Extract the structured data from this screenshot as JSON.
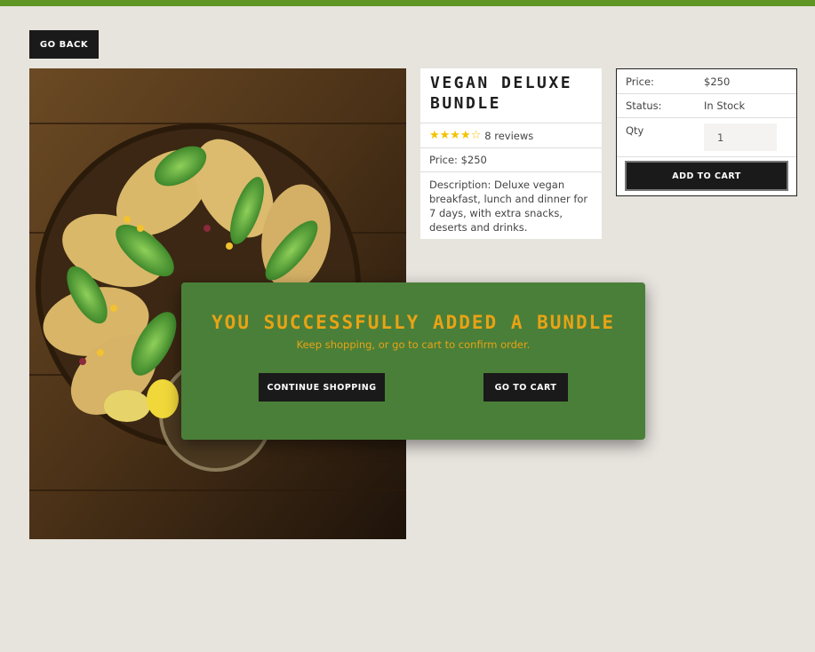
{
  "nav": {
    "back_label": "GO BACK"
  },
  "product": {
    "title": "VEGAN DELUXE BUNDLE",
    "rating": 4,
    "stars": "★★★★☆",
    "reviews": "8 reviews",
    "price": "Price: $250",
    "description": "Description: Deluxe vegan breakfast, lunch and dinner for 7 days, with extra snacks, deserts and drinks.",
    "image_icon": "food-photo"
  },
  "purchase": {
    "price_label": "Price:",
    "price_value": "$250",
    "status_label": "Status:",
    "status_value": "In Stock",
    "qty_label": "Qty",
    "qty_value": "1",
    "add_label": "ADD TO CART"
  },
  "modal": {
    "title": "YOU SUCCESSFULLY ADDED A BUNDLE",
    "subtitle": "Keep shopping, or go to cart to confirm order.",
    "continue_label": "CONTINUE SHOPPING",
    "goto_label": "GO TO CART"
  },
  "colors": {
    "accent_bar": "#5f9623",
    "modal_bg": "#4a7f39",
    "modal_text": "#e8a315",
    "star": "#f2c200"
  }
}
